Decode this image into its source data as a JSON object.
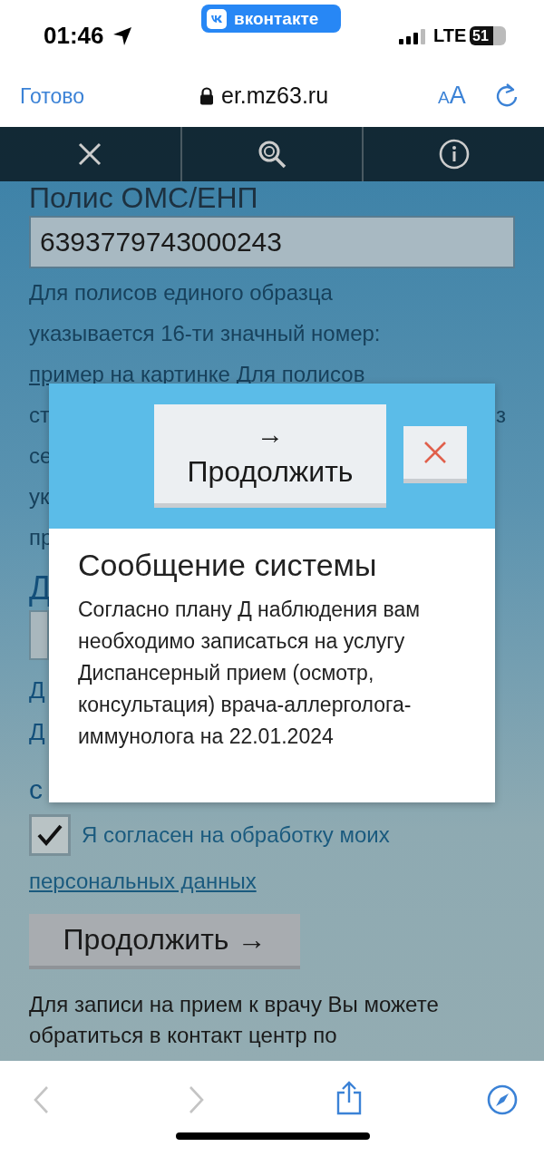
{
  "status_bar": {
    "time": "01:46",
    "badge": "вконтакте",
    "network": "LTE",
    "battery": "51"
  },
  "browser_bar": {
    "done": "Готово",
    "url": "er.mz63.ru",
    "text_size": "AA"
  },
  "page": {
    "policy_label": "Полис ОМС/ЕНП",
    "policy_value": "6393779743000243",
    "hint_lines": [
      {
        "text": "Для полисов единого образца"
      },
      {
        "text": "указывается 16-ти значный номер:"
      },
      {
        "link": "пример на картинке",
        "text": "Для полисов"
      },
      {
        "text": "ст",
        "right": "з"
      },
      {
        "text": "се"
      },
      {
        "text": "ук"
      },
      {
        "text": "пр"
      }
    ],
    "section_heading": "Д",
    "notes": [
      "Д",
      "Д"
    ],
    "consent_heading": "с",
    "consent": {
      "checked": true,
      "text": "Я согласен на обработку моих",
      "link": "персональных данных"
    },
    "continue_button": "Продолжить →",
    "contact_text": "Для записи на прием к врачу Вы можете обратиться в контакт центр по"
  },
  "dialog": {
    "continue_icon": "→",
    "continue_label": "Продолжить",
    "title": "Сообщение системы",
    "message": "Согласно плану Д наблюдения вам необходимо записаться на услугу Диспансерный прием (осмотр, консультация) врача-аллерголога-иммунолога на 22.01.2024"
  },
  "bottom_bar": {
    "back_disabled": true,
    "forward_disabled": true
  }
}
